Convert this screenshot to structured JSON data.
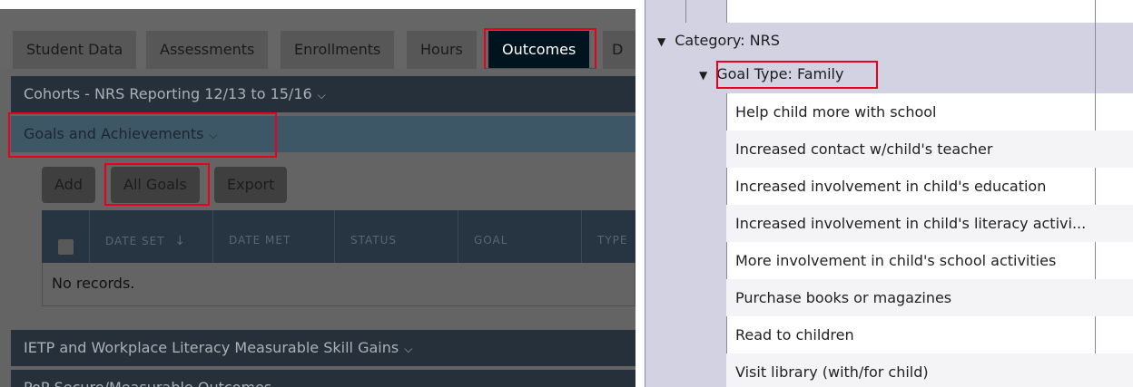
{
  "tabs": [
    {
      "label": "Student Data",
      "active": false
    },
    {
      "label": "Assessments",
      "active": false
    },
    {
      "label": "Enrollments",
      "active": false
    },
    {
      "label": "Hours",
      "active": false
    },
    {
      "label": "Outcomes",
      "active": true
    },
    {
      "label": "D",
      "active": false
    }
  ],
  "sections": {
    "cohorts": "Cohorts - NRS Reporting 12/13 to 15/16",
    "goals": "Goals and Achievements",
    "ietp": "IETP and Workplace Literacy Measurable Skill Gains",
    "partial": "PoP Secure/Measurable Outcomes"
  },
  "buttons": {
    "add": "Add",
    "all_goals": "All Goals",
    "export": "Export"
  },
  "table": {
    "columns": [
      "DATE SET",
      "DATE MET",
      "STATUS",
      "GOAL",
      "TYPE"
    ],
    "sort_indicator": "↓",
    "empty_text": "No records."
  },
  "tree": {
    "category": "Category: NRS",
    "goal_type": "Goal Type: Family",
    "items": [
      "Help child more with school",
      "Increased contact w/child's teacher",
      "Increased involvement in child's education",
      "Increased involvement in child's literacy activi...",
      "More involvement in child's school activities",
      "Purchase books or magazines",
      "Read to children",
      "Visit library (with/for child)"
    ]
  },
  "colors": {
    "highlight": "#e8001c",
    "tree_shade": "#d2d2e3",
    "active_tab": "#00141f"
  }
}
